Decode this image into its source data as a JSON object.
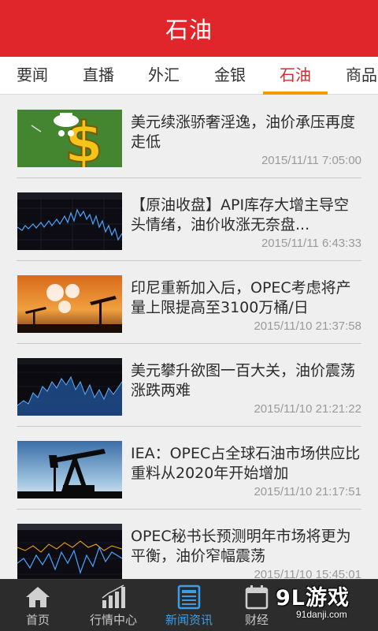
{
  "header": {
    "title": "石油"
  },
  "tabs": [
    {
      "label": "要闻",
      "active": false
    },
    {
      "label": "直播",
      "active": false
    },
    {
      "label": "外汇",
      "active": false
    },
    {
      "label": "金银",
      "active": false
    },
    {
      "label": "石油",
      "active": true
    },
    {
      "label": "商品",
      "active": false
    }
  ],
  "news": [
    {
      "headline": "美元续涨骄奢淫逸，油价承压再度走低",
      "time": "2015/11/11 7:05:00",
      "thumb_icon": "dollar-cartoon-thumbnail"
    },
    {
      "headline": "【原油收盘】API库存大增主导空头情绪，油价收涨无奈盘...",
      "time": "2015/11/11 6:43:33",
      "thumb_icon": "price-chart-thumbnail"
    },
    {
      "headline": "印尼重新加入后，OPEC考虑将产量上限提高至3100万桶/日",
      "time": "2015/11/10 21:37:58",
      "thumb_icon": "opec-pumpjack-thumbnail"
    },
    {
      "headline": "美元攀升欲图一百大关，油价震荡涨跌两难",
      "time": "2015/11/10 21:21:22",
      "thumb_icon": "price-chart-thumbnail"
    },
    {
      "headline": "IEA：OPEC占全球石油市场供应比重料从2020年开始增加",
      "time": "2015/11/10 21:17:51",
      "thumb_icon": "pumpjack-thumbnail"
    },
    {
      "headline": "OPEC秘书长预测明年市场将更为平衡，油价窄幅震荡",
      "time": "2015/11/10 15:45:01",
      "thumb_icon": "price-chart-thumbnail"
    }
  ],
  "bottom_nav": [
    {
      "label": "首页",
      "icon": "home-icon",
      "active": false
    },
    {
      "label": "行情中心",
      "icon": "bar-chart-icon",
      "active": false
    },
    {
      "label": "新闻资讯",
      "icon": "newspaper-icon",
      "active": true
    },
    {
      "label": "财经",
      "icon": "calendar-icon",
      "active": false
    }
  ],
  "watermark": {
    "logo": "9L游戏",
    "url": "91danji.com"
  },
  "colors": {
    "brand_red": "#e0262a",
    "tab_underline": "#f39a00",
    "nav_active": "#3c9ee6",
    "nav_bg": "#2c2c2c"
  }
}
